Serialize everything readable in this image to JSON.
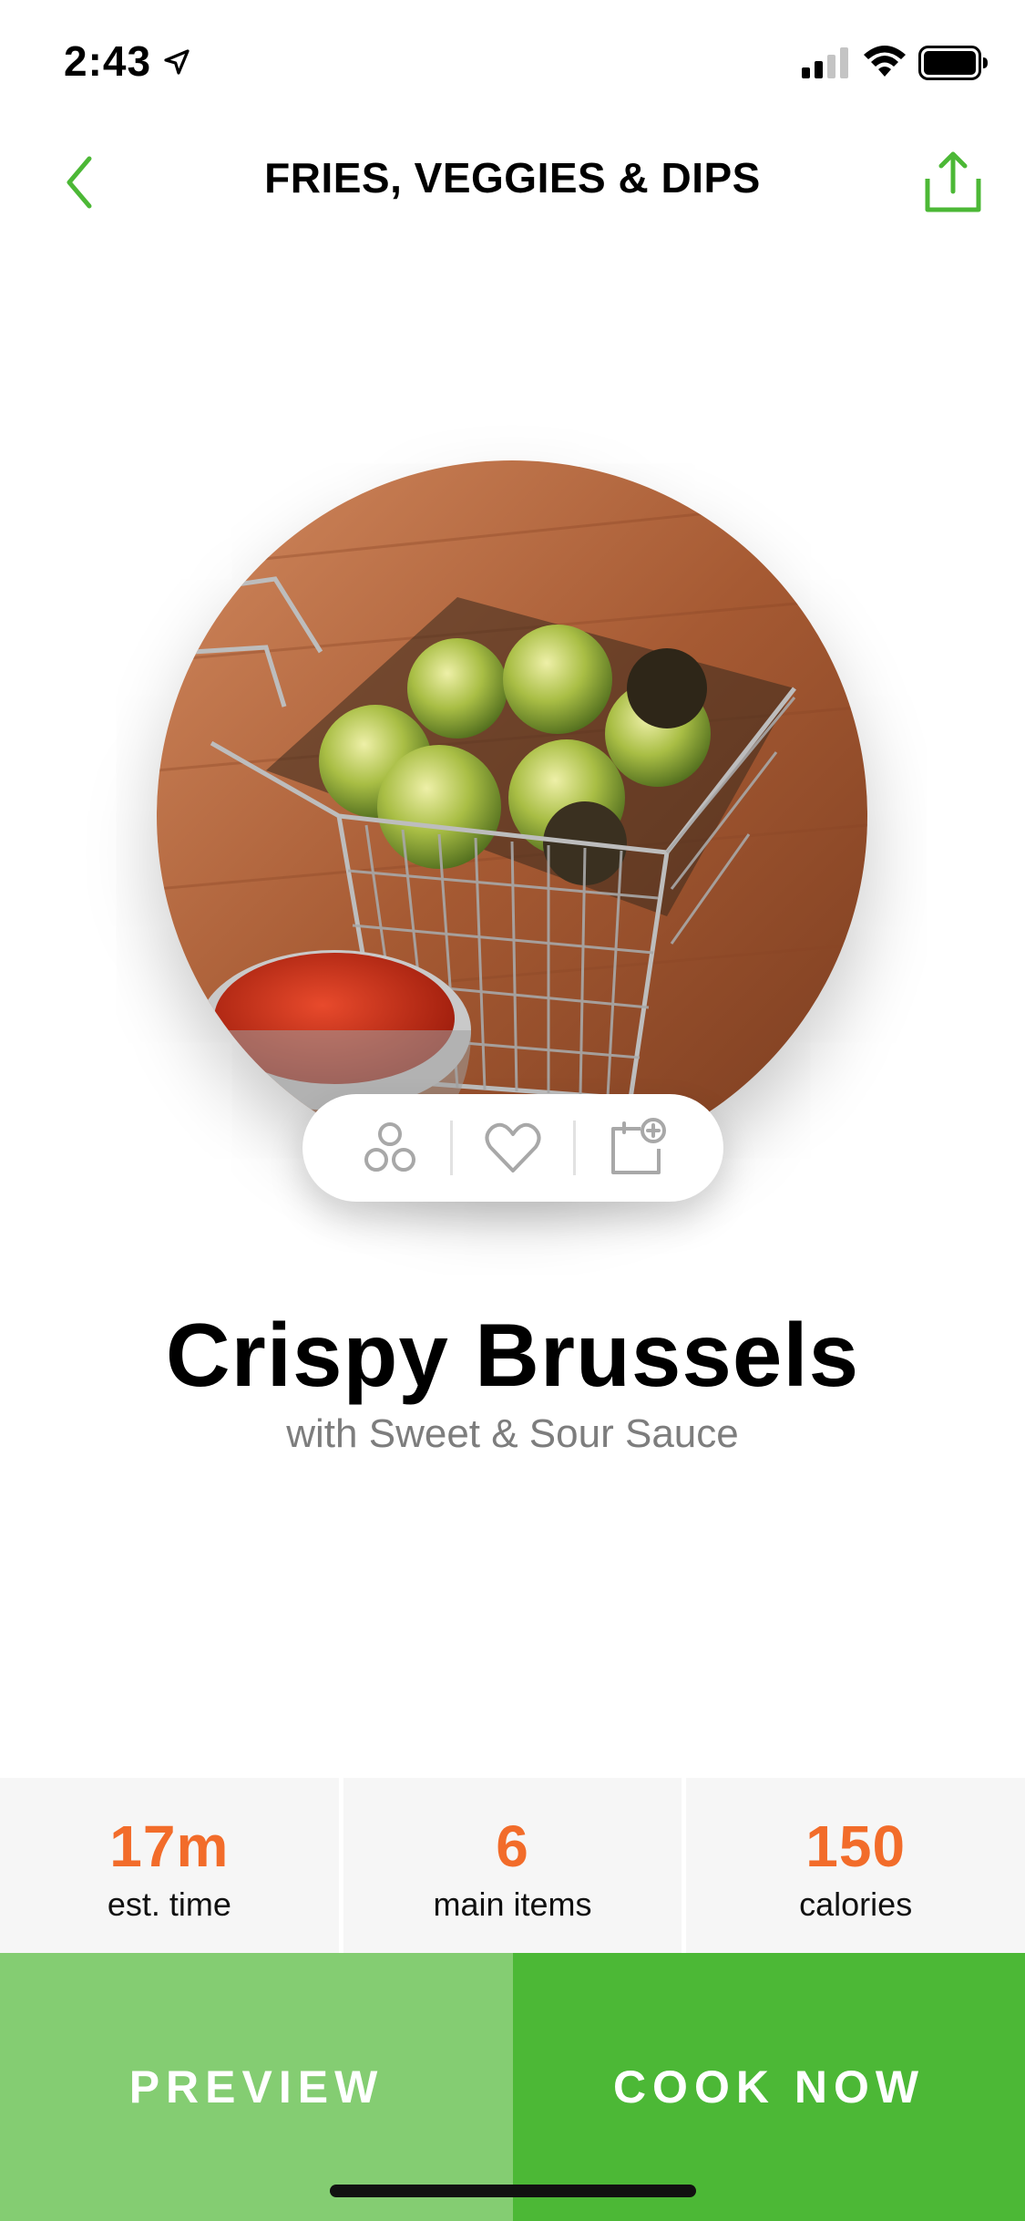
{
  "status_bar": {
    "time": "2:43",
    "icons": [
      "location-arrow-icon",
      "cellular-signal-icon",
      "wifi-icon",
      "battery-icon"
    ]
  },
  "nav": {
    "title": "FRIES, VEGGIES & DIPS",
    "back_icon": "chevron-left-icon",
    "share_icon": "share-icon"
  },
  "hero": {
    "icon": "food-photo"
  },
  "actions": {
    "icons": [
      "ingredients-icon",
      "heart-icon",
      "add-to-calendar-icon"
    ]
  },
  "recipe": {
    "title": "Crispy Brussels",
    "subtitle": "with Sweet & Sour Sauce"
  },
  "stats": [
    {
      "value": "17m",
      "label": "est. time"
    },
    {
      "value": "6",
      "label": "main items"
    },
    {
      "value": "150",
      "label": "calories"
    }
  ],
  "buttons": {
    "preview": "PREVIEW",
    "cook_now": "COOK NOW"
  },
  "colors": {
    "accent_green": "#4cb836",
    "light_green": "#84cd72",
    "stat_orange": "#f26c2a",
    "icon_gray": "#a8a8a8"
  }
}
